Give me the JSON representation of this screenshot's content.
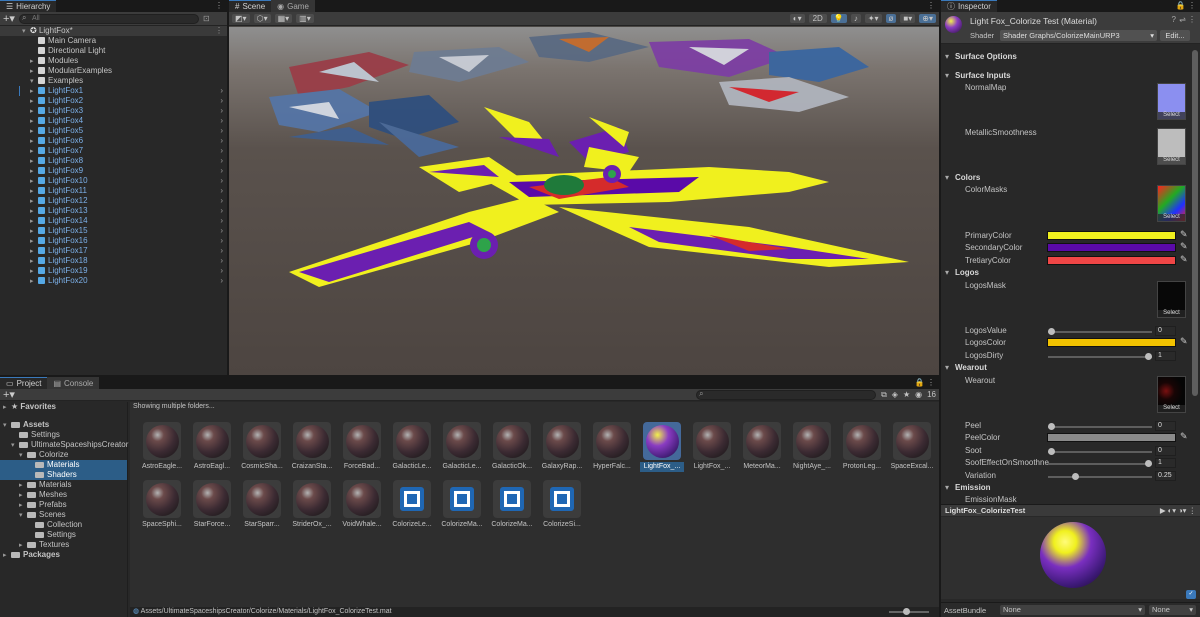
{
  "hierarchy": {
    "tab": "Hierarchy",
    "search_placeholder": "All",
    "scene": "LightFox*",
    "items": [
      "Main Camera",
      "Directional Light",
      "Modules",
      "ModularExamples",
      "Examples"
    ],
    "lightfox": [
      "LightFox1",
      "LightFox2",
      "LightFox3",
      "LightFox4",
      "LightFox5",
      "LightFox6",
      "LightFox7",
      "LightFox8",
      "LightFox9",
      "LightFox10",
      "LightFox11",
      "LightFox12",
      "LightFox13",
      "LightFox14",
      "LightFox15",
      "LightFox16",
      "LightFox17",
      "LightFox18",
      "LightFox19",
      "LightFox20"
    ]
  },
  "scene": {
    "tab_scene": "Scene",
    "tab_game": "Game",
    "mode_2d": "2D"
  },
  "project": {
    "tab_project": "Project",
    "tab_console": "Console",
    "favorites": "Favorites",
    "tree": {
      "assets": "Assets",
      "settings": "Settings",
      "usc": "UltimateSpaceshipsCreator",
      "colorize": "Colorize",
      "materials_sel": "Materials",
      "shaders": "Shaders",
      "materials": "Materials",
      "meshes": "Meshes",
      "prefabs": "Prefabs",
      "scenes": "Scenes",
      "collection": "Collection",
      "settings2": "Settings",
      "textures": "Textures",
      "packages": "Packages"
    },
    "showing": "Showing multiple folders...",
    "count": "16",
    "row1": [
      "AstroEagle...",
      "AstroEagl...",
      "CosmicSha...",
      "CraizanSta...",
      "ForceBad...",
      "GalacticLe...",
      "GalacticLe...",
      "GalacticOk...",
      "GalaxyRap...",
      "HyperFalc...",
      "LightFox_...",
      "LightFox_...",
      "MeteorMa...",
      "NightAye_...",
      "ProtonLeg...",
      "SpaceExcal..."
    ],
    "row2": [
      "SpaceSphi...",
      "StarForce...",
      "StarSparr...",
      "StriderOx_...",
      "VoidWhale...",
      "ColorizeLe...",
      "ColorizeMa...",
      "ColorizeMa...",
      "ColorizeSi..."
    ],
    "path": "Assets/UltimateSpaceshipsCreator/Colorize/Materials/LightFox_ColorizeTest.mat"
  },
  "inspector": {
    "tab": "Inspector",
    "title": "Light Fox_Colorize Test (Material)",
    "shader_label": "Shader",
    "shader_value": "Shader Graphs/ColorizeMainURP3",
    "edit": "Edit...",
    "sections": {
      "surface_options": "Surface Options",
      "surface_inputs": "Surface Inputs",
      "colors": "Colors",
      "logos": "Logos",
      "wearout": "Wearout",
      "emission": "Emission"
    },
    "props": {
      "normalmap": "NormalMap",
      "metallic": "MetallicSmoothness",
      "colormasks": "ColorMasks",
      "primary": "PrimaryColor",
      "secondary": "SecondaryColor",
      "tretiary": "TretiaryColor",
      "logosmask": "LogosMask",
      "logosvalue": "LogosValue",
      "logoscolor": "LogosColor",
      "logosdirty": "LogosDirty",
      "wearout": "Wearout",
      "peel": "Peel",
      "peelcolor": "PeelColor",
      "soot": "Soot",
      "sooteffect": "SoofEffectOnSmoothne",
      "variation": "Variation",
      "emissionmask": "EmissionMask"
    },
    "values": {
      "logosvalue": "0",
      "logosdirty": "1",
      "peel": "0",
      "soot": "0",
      "sooteffect": "1",
      "variation": "0.25"
    },
    "slider_fraction": {
      "logosvalue": 0,
      "logosdirty": 1,
      "peel": 0,
      "soot": 0,
      "sooteffect": 1,
      "variation": 0.25
    },
    "select": "Select",
    "colors": {
      "primary": "#f0f01e",
      "secondary": "#5a0aa8",
      "tretiary": "#f04646",
      "logos": "#f2c200",
      "peel": "#8a8a8a"
    },
    "preview_title": "LightFox_ColorizeTest",
    "assetbundle_label": "AssetBundle",
    "assetbundle_value": "None",
    "assetbundle_variant": "None"
  }
}
